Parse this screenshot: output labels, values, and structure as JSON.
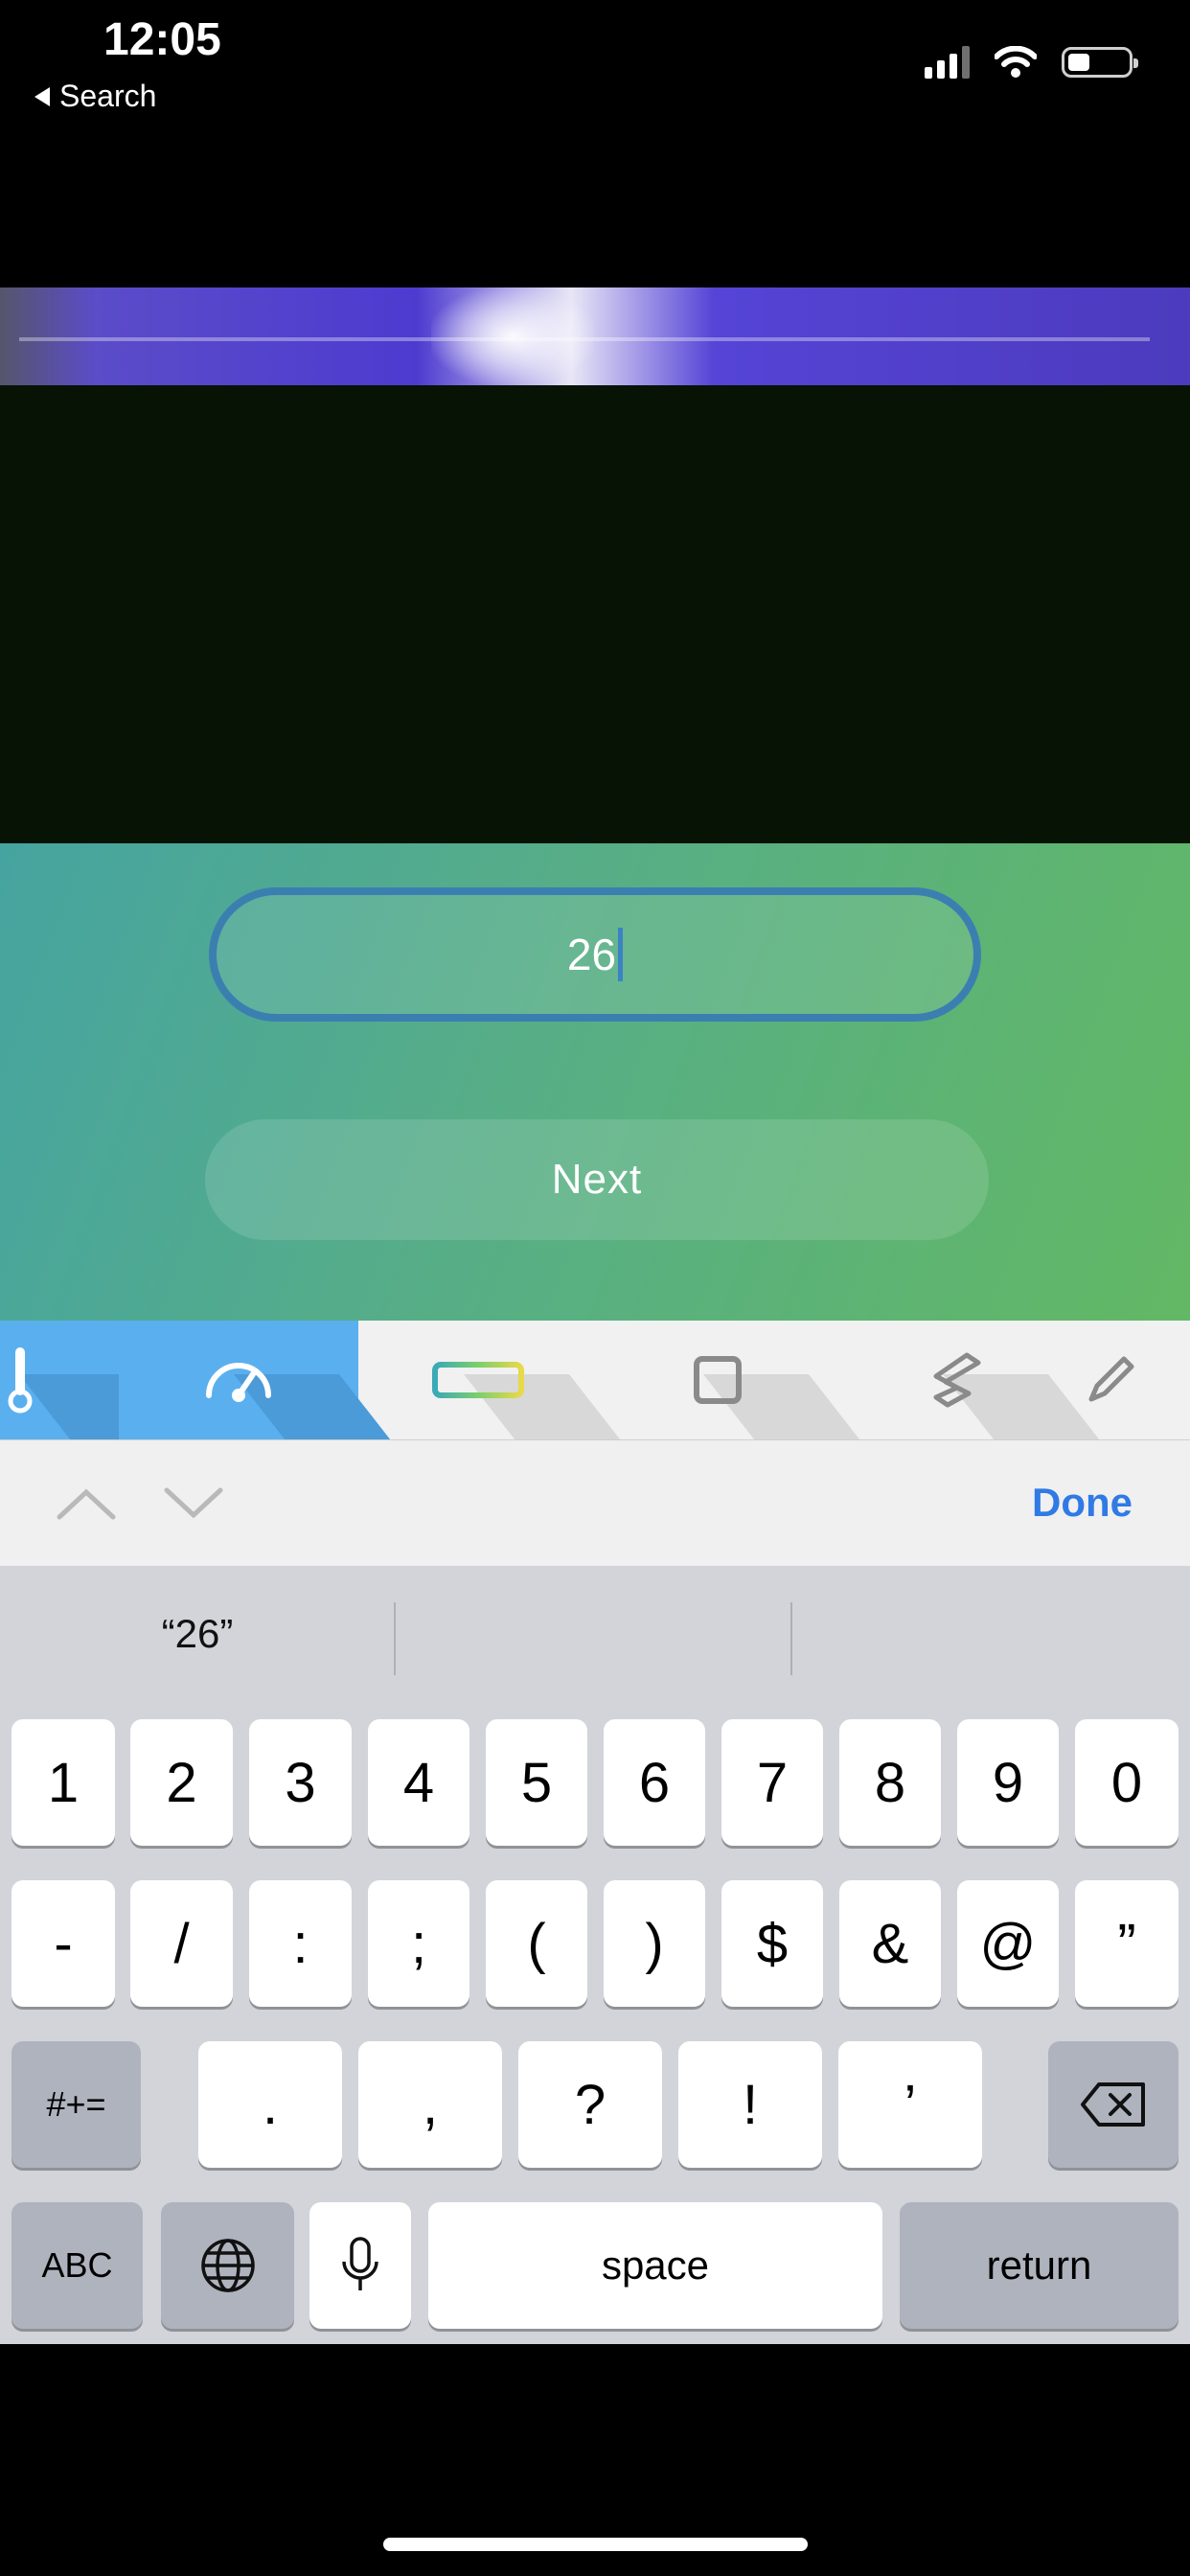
{
  "status_bar": {
    "time": "12:05",
    "back_label": "Search"
  },
  "input": {
    "value": "26"
  },
  "buttons": {
    "next_label": "Next"
  },
  "tools": [
    "thermometer-icon",
    "speedometer-icon",
    "ruler-icon",
    "square-icon",
    "squiggle-icon",
    "pen-icon"
  ],
  "accessory": {
    "done_label": "Done"
  },
  "keyboard": {
    "suggestions": [
      "“26”",
      "",
      ""
    ],
    "row1": [
      "1",
      "2",
      "3",
      "4",
      "5",
      "6",
      "7",
      "8",
      "9",
      "0"
    ],
    "row2": [
      "-",
      "/",
      ":",
      ";",
      "(",
      ")",
      "$",
      "&",
      "@",
      "”"
    ],
    "row3": [
      ".",
      ",",
      "?",
      "!",
      "’"
    ],
    "symbols_label": "#+=",
    "abc_label": "ABC",
    "space_label": "space",
    "return_label": "return"
  }
}
